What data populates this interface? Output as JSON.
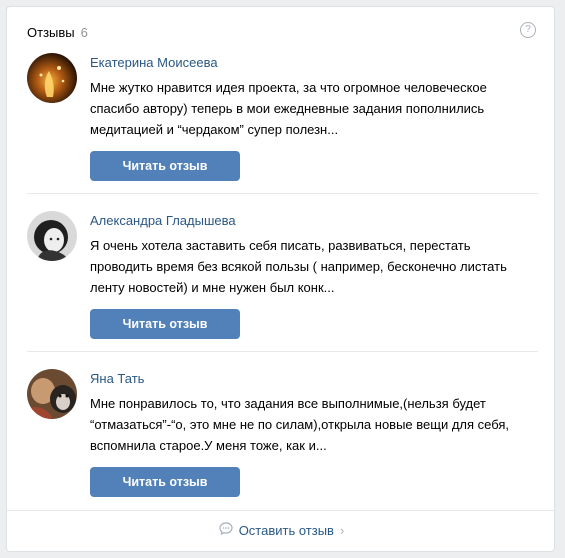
{
  "header": {
    "title": "Отзывы",
    "count": "6",
    "help_icon": "question-icon"
  },
  "reviews": [
    {
      "name": "Екатерина Моисеева",
      "text": "Мне жутко нравится идея проекта, за что огромное человеческое спасибо автору) теперь в мои ежедневные задания пополнились медитацией и “чердаком” супер полезн...",
      "button": "Читать отзыв"
    },
    {
      "name": "Александра Гладышева",
      "text": "Я очень хотела заставить себя писать, развиваться, перестать проводить время без всякой пользы ( например, бесконечно листать ленту новостей) и мне нужен был конк...",
      "button": "Читать отзыв"
    },
    {
      "name": "Яна Тать",
      "text": "Мне понравилось то, что задания все выполнимые,(нельзя будет “отмазаться”-“о, это мне не по силам),открыла новые вещи для себя, вспомнила старое.У меня тоже, как и...",
      "button": "Читать отзыв"
    }
  ],
  "footer": {
    "label": "Оставить отзыв",
    "icon": "comment-icon",
    "chevron_icon": "chevron-right-icon"
  },
  "colors": {
    "accent": "#5181b8",
    "link": "#2a5885",
    "background": "#edeef0"
  }
}
